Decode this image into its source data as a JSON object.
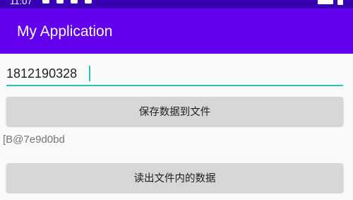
{
  "status_bar": {
    "time": "11:07"
  },
  "app_bar": {
    "title": "My Application"
  },
  "input": {
    "value": "1812190328"
  },
  "buttons": {
    "save_label": "保存数据到文件",
    "read_label": "读出文件内的数据"
  },
  "result": {
    "text": "[B@7e9d0bd"
  },
  "colors": {
    "status_bar": "#3700b3",
    "app_bar": "#6200ee",
    "accent": "#26c6bd",
    "button_bg": "#d7d7d7"
  }
}
